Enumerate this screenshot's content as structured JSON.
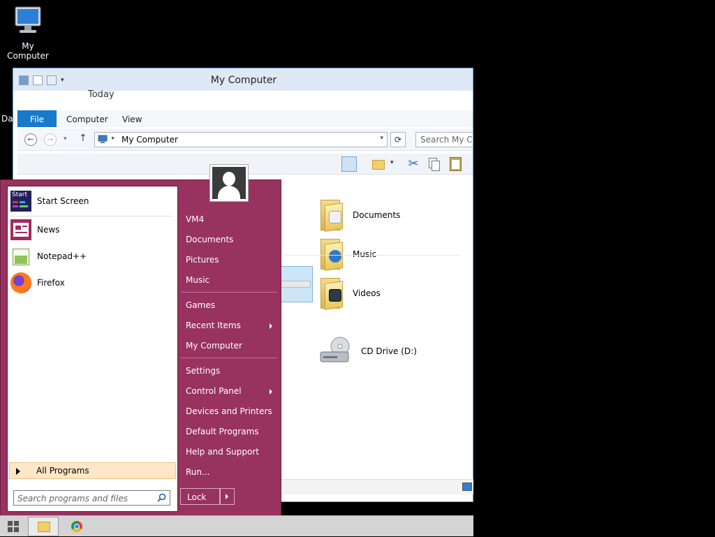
{
  "desktop": {
    "icon_label": "My Computer",
    "partial_label": "Da"
  },
  "explorer": {
    "title": "My Computer",
    "today_label": "Today",
    "tabs": {
      "file": "File",
      "computer": "Computer",
      "view": "View"
    },
    "address": "My Computer",
    "search_placeholder": "Search My Co",
    "items": {
      "documents": "Documents",
      "music": "Music",
      "videos": "Videos",
      "cd_drive": "CD Drive (D:)"
    }
  },
  "start_menu": {
    "left_items": {
      "start_screen": "Start Screen",
      "news": "News",
      "notepad": "Notepad++",
      "firefox": "Firefox"
    },
    "all_programs": "All Programs",
    "search_placeholder": "Search programs and files",
    "right_items": {
      "vm4": "VM4",
      "documents": "Documents",
      "pictures": "Pictures",
      "music": "Music",
      "games": "Games",
      "recent_items": "Recent Items",
      "my_computer": "My Computer",
      "settings": "Settings",
      "control_panel": "Control Panel",
      "devices_printers": "Devices and Printers",
      "default_programs": "Default Programs",
      "help_support": "Help and Support",
      "run": "Run..."
    },
    "lock_label": "Lock",
    "start_tile_text": "Start"
  },
  "colors": {
    "start_menu_bg": "#98325f",
    "ribbon_file_tab": "#1979ca",
    "all_programs_highlight": "#fde7c6"
  }
}
